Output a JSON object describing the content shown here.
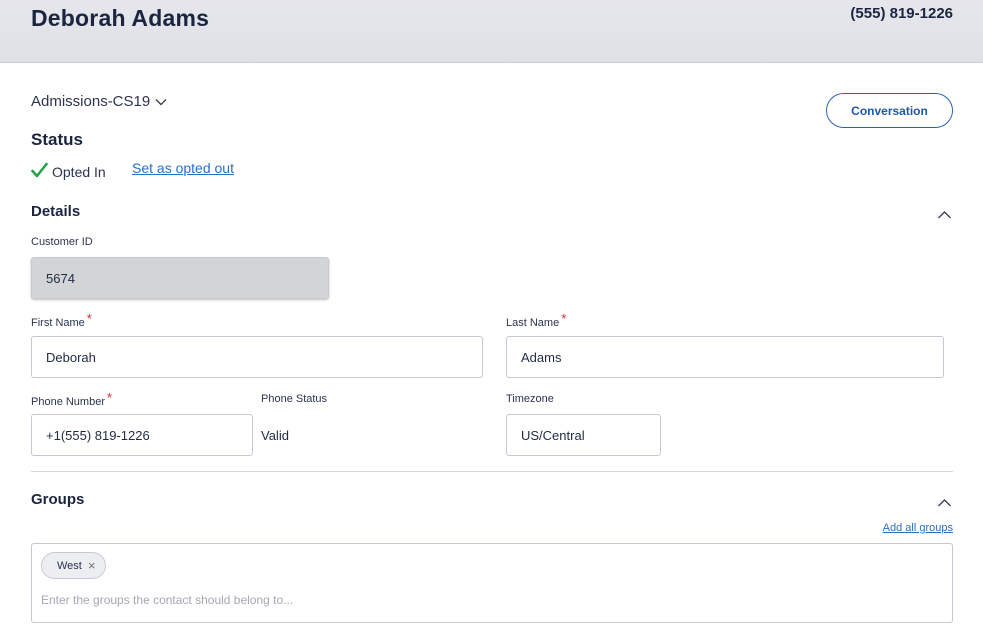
{
  "header": {
    "contact_name": "Deborah Adams",
    "phone": "(555) 819-1226"
  },
  "campaign": {
    "label": "Admissions-CS19",
    "icon": "chevron-down-icon"
  },
  "conversation_button": {
    "label": "Conversation"
  },
  "status": {
    "title": "Status",
    "value": "Opted In",
    "icon": "checkmark-icon",
    "action_label": "Set as opted out"
  },
  "details": {
    "title": "Details",
    "customer_id": {
      "label": "Customer ID",
      "value": "5674"
    },
    "first_name": {
      "label": "First Name",
      "value": "Deborah",
      "required_mark": "*"
    },
    "last_name": {
      "label": "Last Name",
      "value": "Adams",
      "required_mark": "*"
    },
    "phone_number": {
      "label": "Phone Number",
      "value": "+1(555) 819-1226",
      "required_mark": "*"
    },
    "phone_status": {
      "label": "Phone Status",
      "value": "Valid"
    },
    "timezone": {
      "label": "Timezone",
      "value": "US/Central"
    }
  },
  "groups": {
    "title": "Groups",
    "add_all_label": "Add all groups",
    "chips": [
      {
        "label": "West",
        "close": "×"
      }
    ],
    "placeholder": "Enter the groups the contact should belong to..."
  },
  "colors": {
    "accent": "#2a63b8",
    "link": "#2a6ec4",
    "required": "#d12b2b",
    "check": "#22a447",
    "header_bg": "#e3e4e9"
  }
}
